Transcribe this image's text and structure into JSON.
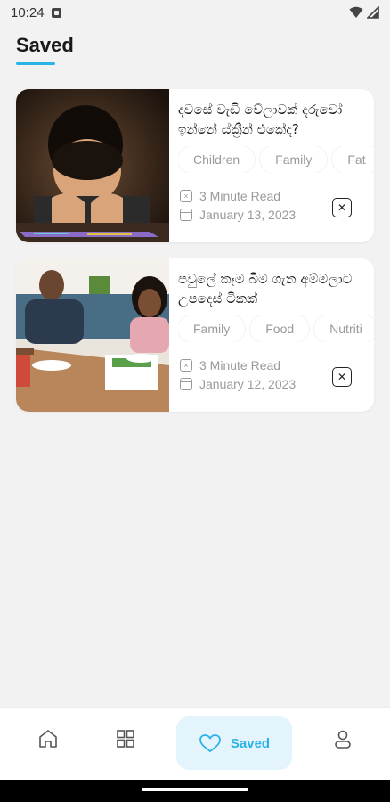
{
  "status_bar": {
    "time": "10:24"
  },
  "page": {
    "title": "Saved",
    "accent_color": "#2bb3e8"
  },
  "articles": [
    {
      "title": "දවසේ වැඩි වේලාවක් දරුවෝ ඉන්නේ ස්ක්‍රීන් එකේද?",
      "tags": [
        "Children",
        "Family",
        "Fat"
      ],
      "read_time": "3 Minute Read",
      "date": "January 13, 2023",
      "image": "boy-looking-at-tablet"
    },
    {
      "title": "පවුලේ කෑම බීම ගැන අම්මලාට උපදෙස් ටිකක්",
      "tags": [
        "Family",
        "Food",
        "Nutriti"
      ],
      "read_time": "3 Minute Read",
      "date": "January 12, 2023",
      "image": "family-dinner"
    }
  ],
  "bottom_nav": {
    "items": [
      {
        "icon": "home-icon"
      },
      {
        "icon": "grid-icon"
      },
      {
        "icon": "heart-icon",
        "label": "Saved",
        "active": true
      },
      {
        "icon": "profile-icon"
      }
    ]
  }
}
